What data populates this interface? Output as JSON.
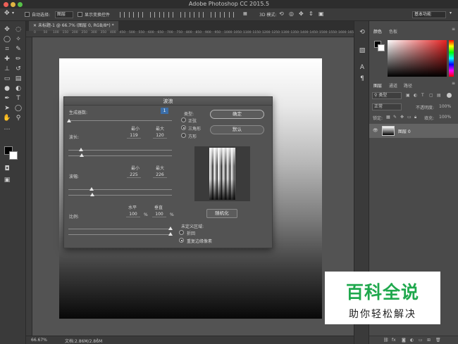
{
  "app": {
    "title": "Adobe Photoshop CC 2015.5",
    "workspace": "基本功能"
  },
  "options_bar": {
    "auto_select_label": "自动选择:",
    "auto_select_value": "图层",
    "show_transform_label": "显示变换控件",
    "mode_3d_label": "3D 模式:"
  },
  "document": {
    "tab_title": "未标题-1 @ 66.7% (图层 0, RGB/8*) *",
    "ruler_ticks": [
      "0",
      "50",
      "100",
      "150",
      "200",
      "250",
      "300",
      "350",
      "400",
      "450",
      "500",
      "550",
      "600",
      "650",
      "700",
      "750",
      "800",
      "850",
      "900",
      "950",
      "1000",
      "1050",
      "1100",
      "1150",
      "1200",
      "1250",
      "1300",
      "1350",
      "1400",
      "1450",
      "1500",
      "1550",
      "1600",
      "1650"
    ],
    "zoom": "66.67%",
    "doc_info": "文档:2.86M/2.86M"
  },
  "panels": {
    "color_tab": "颜色",
    "swatches_tab": "色板",
    "layers_tab": "图层",
    "channels_tab": "通道",
    "paths_tab": "路径",
    "filter_kind": "类型",
    "blend_mode": "正常",
    "opacity_label": "不透明度:",
    "opacity_value": "100%",
    "lock_label": "锁定:",
    "fill_label": "填充:",
    "fill_value": "100%",
    "layer_name": "图层 0"
  },
  "dialog": {
    "title": "波浪",
    "generators_label": "生成器数:",
    "generators_value": "1",
    "wavelength_label": "波长:",
    "amplitude_label": "波幅:",
    "scale_label": "比例:",
    "min_label": "最小",
    "max_label": "最大",
    "horiz_label": "水平",
    "vert_label": "垂直",
    "wavelength_min": "119",
    "wavelength_max": "120",
    "amplitude_min": "225",
    "amplitude_max": "226",
    "scale_h": "100",
    "scale_v": "100",
    "percent": "%",
    "type_label": "类型:",
    "type_sine": "正弦",
    "type_triangle": "三角形",
    "type_square": "方形",
    "ok_button": "确定",
    "default_button": "默认",
    "randomize_button": "随机化",
    "undefined_label": "未定义区域:",
    "wrap_around": "折回",
    "repeat_edge": "重复边缘像素"
  },
  "watermark": {
    "title": "百科全说",
    "subtitle": "助你轻松解决",
    "color": "#1fa84d"
  }
}
